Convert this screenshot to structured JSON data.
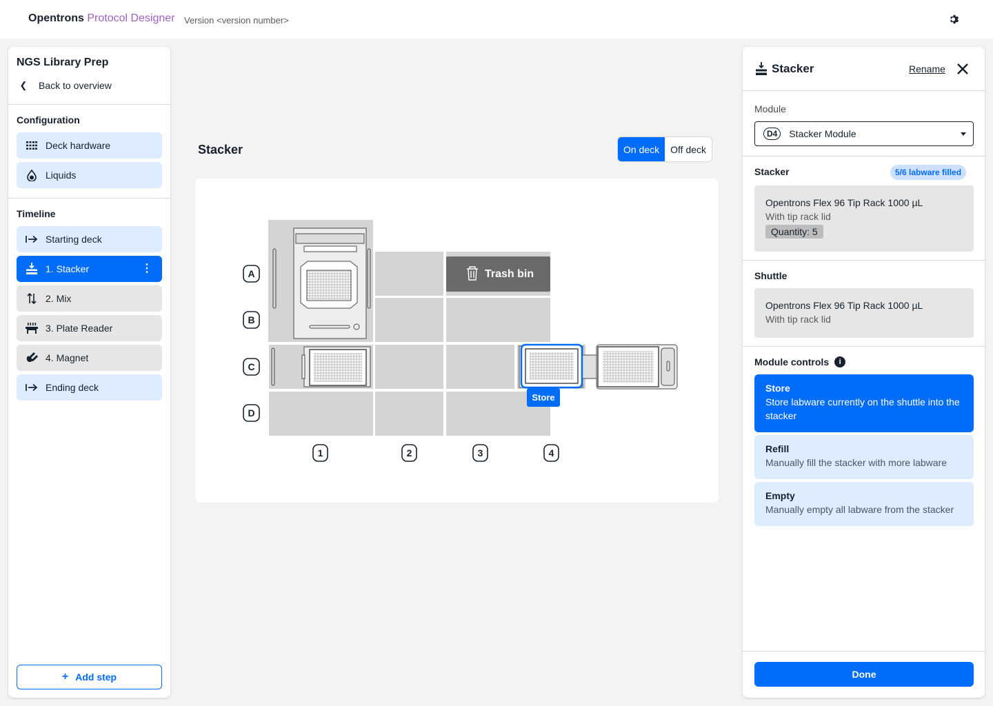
{
  "topbar": {
    "brand_main": "Opentrons",
    "brand_sub": "Protocol Designer",
    "version": "Version <version number>",
    "settings_icon": "gear-icon"
  },
  "sidebar": {
    "protocol_name": "NGS Library Prep",
    "back_label": "Back to overview",
    "configuration_label": "Configuration",
    "configuration_items": [
      {
        "label": "Deck hardware",
        "icon": "grid-icon"
      },
      {
        "label": "Liquids",
        "icon": "droplet-icon"
      }
    ],
    "timeline_label": "Timeline",
    "timeline_items": [
      {
        "label": "Starting deck",
        "icon": "arrow-right-icon",
        "state": "blue"
      },
      {
        "label": "1. Stacker",
        "icon": "stacker-icon",
        "state": "active"
      },
      {
        "label": "2. Mix",
        "icon": "mix-icon",
        "state": "grey"
      },
      {
        "label": "3. Plate Reader",
        "icon": "plate-reader-icon",
        "state": "grey"
      },
      {
        "label": "4. Magnet",
        "icon": "magnet-icon",
        "state": "grey"
      },
      {
        "label": "Ending deck",
        "icon": "arrow-right-icon",
        "state": "blue"
      }
    ],
    "add_step_label": "Add step"
  },
  "center": {
    "title": "Stacker",
    "toggle": {
      "on_deck": "On deck",
      "off_deck": "Off deck",
      "selected": "On deck"
    },
    "deck": {
      "rows": [
        "A",
        "B",
        "C",
        "D"
      ],
      "columns": [
        "1",
        "2",
        "3",
        "4"
      ],
      "trash_label": "Trash bin",
      "store_tag": "Store"
    }
  },
  "panel": {
    "title": "Stacker",
    "rename_label": "Rename",
    "module_label": "Module",
    "module_slot": "D4",
    "module_value": "Stacker Module",
    "stacker_label": "Stacker",
    "fill_status": "5/6 labware filled",
    "stacker_labware": {
      "name": "Opentrons Flex 96 Tip Rack 1000 µL",
      "lid": "With tip rack lid",
      "quantity": "Quantity: 5"
    },
    "shuttle_label": "Shuttle",
    "shuttle_labware": {
      "name": "Opentrons Flex 96 Tip Rack 1000 µL",
      "lid": "With tip rack lid"
    },
    "module_controls_label": "Module controls",
    "controls": [
      {
        "title": "Store",
        "desc": "Store labware currently on the shuttle into the stacker",
        "selected": true
      },
      {
        "title": "Refill",
        "desc": "Manually fill the stacker with more labware",
        "selected": false
      },
      {
        "title": "Empty",
        "desc": "Manually empty all labware from the stacker",
        "selected": false
      }
    ],
    "done_label": "Done"
  },
  "colors": {
    "primary": "#006cfa",
    "light_blue": "#deecff",
    "brand_purple": "#9e5fc5"
  }
}
